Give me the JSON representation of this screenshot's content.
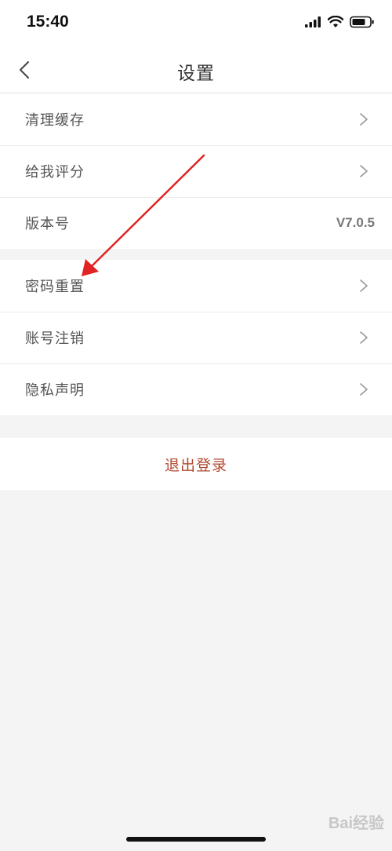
{
  "status_bar": {
    "time": "15:40",
    "icons": [
      "cellular-signal-icon",
      "wifi-icon",
      "battery-icon"
    ]
  },
  "nav": {
    "title": "设置",
    "back_icon": "chevron-left-icon"
  },
  "group1": [
    {
      "label": "清理缓存",
      "chevron": true
    },
    {
      "label": "给我评分",
      "chevron": true
    },
    {
      "label": "版本号",
      "value": "V7.0.5"
    }
  ],
  "group2": [
    {
      "label": "密码重置",
      "chevron": true
    },
    {
      "label": "账号注销",
      "chevron": true
    },
    {
      "label": "隐私声明",
      "chevron": true
    }
  ],
  "logout": {
    "label": "退出登录"
  },
  "watermark": "Bai经验",
  "colors": {
    "background": "#f4f4f4",
    "logout_text": "#b2482f",
    "annotation_arrow": "#e02424"
  }
}
